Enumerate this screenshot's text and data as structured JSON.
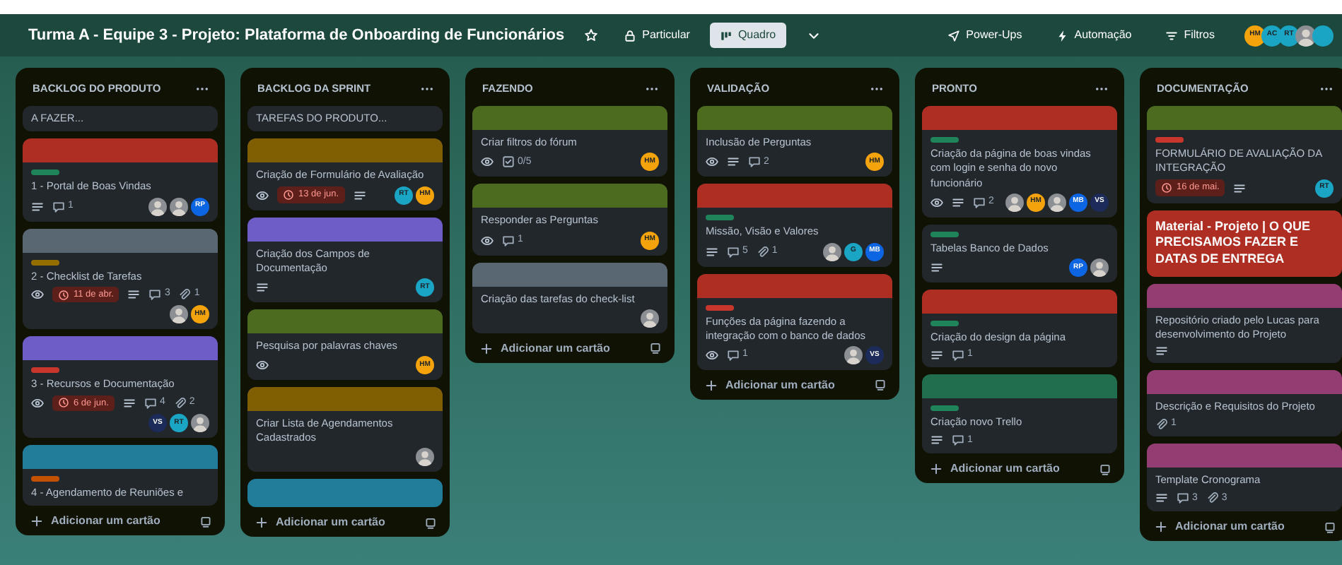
{
  "header": {
    "title": "Turma A - Equipe 3 - Projeto: Plataforma de Onboarding de Funcionários",
    "visibility": "Particular",
    "view": "Quadro",
    "actions": [
      {
        "label": "Power-Ups"
      },
      {
        "label": "Automação"
      },
      {
        "label": "Filtros"
      }
    ],
    "members": [
      {
        "kind": "initials",
        "initials": "HM",
        "color": "#f5a30a"
      },
      {
        "kind": "initials",
        "initials": "AC",
        "color": "#1aa5c4"
      },
      {
        "kind": "initials",
        "initials": "RT",
        "color": "#1aa5c4"
      },
      {
        "kind": "photo"
      },
      {
        "kind": "blank",
        "color": "#1aa5c4"
      }
    ]
  },
  "lists": [
    {
      "title": "BACKLOG DO PRODUTO",
      "add_card": "Adicionar um cartão",
      "cards": [
        {
          "kind": "card",
          "title": "A FAZER..."
        },
        {
          "kind": "card",
          "cover": {
            "color": "#ae2e24"
          },
          "label": {
            "color": "#1f845a"
          },
          "title": "1 - Portal de Boas Vindas",
          "badges": [
            {
              "kind": "description"
            },
            {
              "kind": "comments",
              "text": "1"
            }
          ],
          "members": [
            {
              "kind": "photo"
            },
            {
              "kind": "photo"
            },
            {
              "kind": "initials",
              "initials": "RP",
              "color": "#0c66e4"
            }
          ]
        },
        {
          "kind": "card",
          "cover": {
            "color": "#596773"
          },
          "label": {
            "color": "#946f00"
          },
          "title": "2 - Checklist de Tarefas",
          "badges": [
            {
              "kind": "watch"
            },
            {
              "kind": "due",
              "text": "11 de abr."
            },
            {
              "kind": "description"
            },
            {
              "kind": "comments",
              "text": "3"
            },
            {
              "kind": "attachments",
              "text": "1"
            }
          ],
          "members": [
            {
              "kind": "photo"
            },
            {
              "kind": "initials",
              "initials": "HM",
              "color": "#f5a30a"
            }
          ]
        },
        {
          "kind": "card",
          "cover": {
            "color": "#6e5dc6"
          },
          "label": {
            "color": "#c9372c"
          },
          "title": "3 - Recursos e Documentação",
          "badges": [
            {
              "kind": "watch"
            },
            {
              "kind": "due",
              "text": "6 de jun."
            },
            {
              "kind": "description"
            },
            {
              "kind": "comments",
              "text": "4"
            },
            {
              "kind": "attachments",
              "text": "2"
            }
          ],
          "members": [
            {
              "kind": "initials",
              "initials": "VS",
              "color": "#1c2b59"
            },
            {
              "kind": "initials",
              "initials": "RT",
              "color": "#1aa5c4"
            },
            {
              "kind": "photo"
            }
          ]
        },
        {
          "kind": "card",
          "cover": {
            "color": "#227d9b"
          },
          "label": {
            "color": "#c25100"
          },
          "title": "4 - Agendamento de Reuniões e"
        }
      ]
    },
    {
      "title": "BACKLOG DA SPRINT",
      "add_card": "Adicionar um cartão",
      "cards": [
        {
          "kind": "card",
          "title": "TAREFAS DO PRODUTO..."
        },
        {
          "kind": "card",
          "cover": {
            "color": "#7f5f01"
          },
          "title": "Criação de Formulário de Avaliação",
          "badges": [
            {
              "kind": "watch"
            },
            {
              "kind": "due",
              "text": "13 de jun."
            },
            {
              "kind": "description"
            }
          ],
          "members": [
            {
              "kind": "initials",
              "initials": "RT",
              "color": "#1aa5c4"
            },
            {
              "kind": "initials",
              "initials": "HM",
              "color": "#f5a30a"
            }
          ]
        },
        {
          "kind": "card",
          "cover": {
            "color": "#6e5dc6"
          },
          "title": "Criação dos Campos de Documentação",
          "badges": [
            {
              "kind": "description"
            }
          ],
          "members": [
            {
              "kind": "initials",
              "initials": "RT",
              "color": "#1aa5c4"
            }
          ]
        },
        {
          "kind": "card",
          "cover": {
            "color": "#4c6b1f"
          },
          "title": "Pesquisa por palavras chaves",
          "badges": [
            {
              "kind": "watch"
            }
          ],
          "members": [
            {
              "kind": "initials",
              "initials": "HM",
              "color": "#f5a30a"
            }
          ]
        },
        {
          "kind": "card",
          "cover": {
            "color": "#7f5f01"
          },
          "title": "Criar Lista de Agendamentos Cadastrados",
          "members": [
            {
              "kind": "photo"
            }
          ]
        },
        {
          "kind": "card",
          "cover": {
            "color": "#227d9b"
          }
        }
      ]
    },
    {
      "title": "FAZENDO",
      "add_card": "Adicionar um cartão",
      "cards": [
        {
          "kind": "card",
          "cover": {
            "color": "#4c6b1f"
          },
          "title": "Criar filtros do fórum",
          "badges": [
            {
              "kind": "watch"
            },
            {
              "kind": "checklist",
              "text": "0/5"
            }
          ],
          "members": [
            {
              "kind": "initials",
              "initials": "HM",
              "color": "#f5a30a"
            }
          ]
        },
        {
          "kind": "card",
          "cover": {
            "color": "#4c6b1f"
          },
          "title": "Responder as Perguntas",
          "badges": [
            {
              "kind": "watch"
            },
            {
              "kind": "comments",
              "text": "1"
            }
          ],
          "members": [
            {
              "kind": "initials",
              "initials": "HM",
              "color": "#f5a30a"
            }
          ]
        },
        {
          "kind": "card",
          "cover": {
            "color": "#596773"
          },
          "title": "Criação das tarefas do check-list",
          "members": [
            {
              "kind": "photo"
            }
          ]
        }
      ]
    },
    {
      "title": "VALIDAÇÃO",
      "add_card": "Adicionar um cartão",
      "cards": [
        {
          "kind": "card",
          "cover": {
            "color": "#4c6b1f"
          },
          "title": "Inclusão de Perguntas",
          "badges": [
            {
              "kind": "watch"
            },
            {
              "kind": "description"
            },
            {
              "kind": "comments",
              "text": "2"
            }
          ],
          "members": [
            {
              "kind": "initials",
              "initials": "HM",
              "color": "#f5a30a"
            }
          ]
        },
        {
          "kind": "card",
          "cover": {
            "color": "#ae2e24"
          },
          "label": {
            "color": "#1f845a"
          },
          "title": "Missão, Visão e Valores",
          "badges": [
            {
              "kind": "description"
            },
            {
              "kind": "comments",
              "text": "5"
            },
            {
              "kind": "attachments",
              "text": "1"
            }
          ],
          "members": [
            {
              "kind": "photo"
            },
            {
              "kind": "initials",
              "initials": "G",
              "color": "#1aa5c4"
            },
            {
              "kind": "initials",
              "initials": "MB",
              "color": "#0c66e4"
            }
          ]
        },
        {
          "kind": "card",
          "cover": {
            "color": "#ae2e24"
          },
          "label": {
            "color": "#c9372c"
          },
          "title": "Funções da página fazendo a integração com o banco de dados",
          "badges": [
            {
              "kind": "watch"
            },
            {
              "kind": "comments",
              "text": "1"
            }
          ],
          "members": [
            {
              "kind": "photo"
            },
            {
              "kind": "initials",
              "initials": "VS",
              "color": "#1c2b59"
            }
          ]
        }
      ]
    },
    {
      "title": "PRONTO",
      "add_card": "Adicionar um cartão",
      "cards": [
        {
          "kind": "card",
          "cover": {
            "color": "#ae2e24"
          },
          "label": {
            "color": "#1f845a"
          },
          "title": "Criação da página de boas vindas com login e senha do novo funcionário",
          "badges": [
            {
              "kind": "watch"
            },
            {
              "kind": "description"
            },
            {
              "kind": "comments",
              "text": "2"
            }
          ],
          "members": [
            {
              "kind": "photo"
            },
            {
              "kind": "initials",
              "initials": "HM",
              "color": "#f5a30a"
            },
            {
              "kind": "photo"
            },
            {
              "kind": "initials",
              "initials": "MB",
              "color": "#0c66e4"
            },
            {
              "kind": "initials",
              "initials": "VS",
              "color": "#1c2b59"
            }
          ]
        },
        {
          "kind": "card",
          "label": {
            "color": "#1f845a"
          },
          "title": "Tabelas Banco de Dados",
          "badges": [
            {
              "kind": "description"
            }
          ],
          "members": [
            {
              "kind": "initials",
              "initials": "RP",
              "color": "#0c66e4"
            },
            {
              "kind": "photo"
            }
          ]
        },
        {
          "kind": "card",
          "cover": {
            "color": "#ae2e24"
          },
          "label": {
            "color": "#1f845a"
          },
          "title": "Criação do design da página",
          "badges": [
            {
              "kind": "description"
            },
            {
              "kind": "comments",
              "text": "1"
            }
          ]
        },
        {
          "kind": "card",
          "cover": {
            "color": "#216e4e"
          },
          "label": {
            "color": "#1f845a"
          },
          "title": "Criação novo Trello",
          "badges": [
            {
              "kind": "description"
            },
            {
              "kind": "comments",
              "text": "1"
            }
          ]
        }
      ]
    },
    {
      "title": "DOCUMENTAÇÃO",
      "add_card": "Adicionar um cartão",
      "cards": [
        {
          "kind": "card",
          "cover": {
            "color": "#4c6b1f"
          },
          "label": {
            "color": "#c9372c"
          },
          "title": "FORMULÁRIO DE AVALIAÇÃO DA INTEGRAÇÃO",
          "badges": [
            {
              "kind": "due",
              "text": "16 de mai."
            },
            {
              "kind": "description"
            }
          ],
          "members": [
            {
              "kind": "initials",
              "initials": "RT",
              "color": "#1aa5c4"
            }
          ]
        },
        {
          "kind": "full_cover",
          "cover": {
            "color": "#ae2e24"
          },
          "title": "Material - Projeto | O QUE PRECISAMOS FAZER E DATAS DE ENTREGA"
        },
        {
          "kind": "card",
          "cover": {
            "color": "#943d73"
          },
          "title": "Repositório criado pelo Lucas para desenvolvimento do Projeto",
          "badges": [
            {
              "kind": "description"
            }
          ]
        },
        {
          "kind": "card",
          "cover": {
            "color": "#943d73"
          },
          "title": "Descrição e Requisitos do Projeto",
          "badges": [
            {
              "kind": "attachments",
              "text": "1"
            }
          ]
        },
        {
          "kind": "card",
          "cover": {
            "color": "#943d73"
          },
          "title": "Template Cronograma",
          "badges": [
            {
              "kind": "description"
            },
            {
              "kind": "comments",
              "text": "3"
            },
            {
              "kind": "attachments",
              "text": "3"
            }
          ]
        }
      ]
    }
  ]
}
